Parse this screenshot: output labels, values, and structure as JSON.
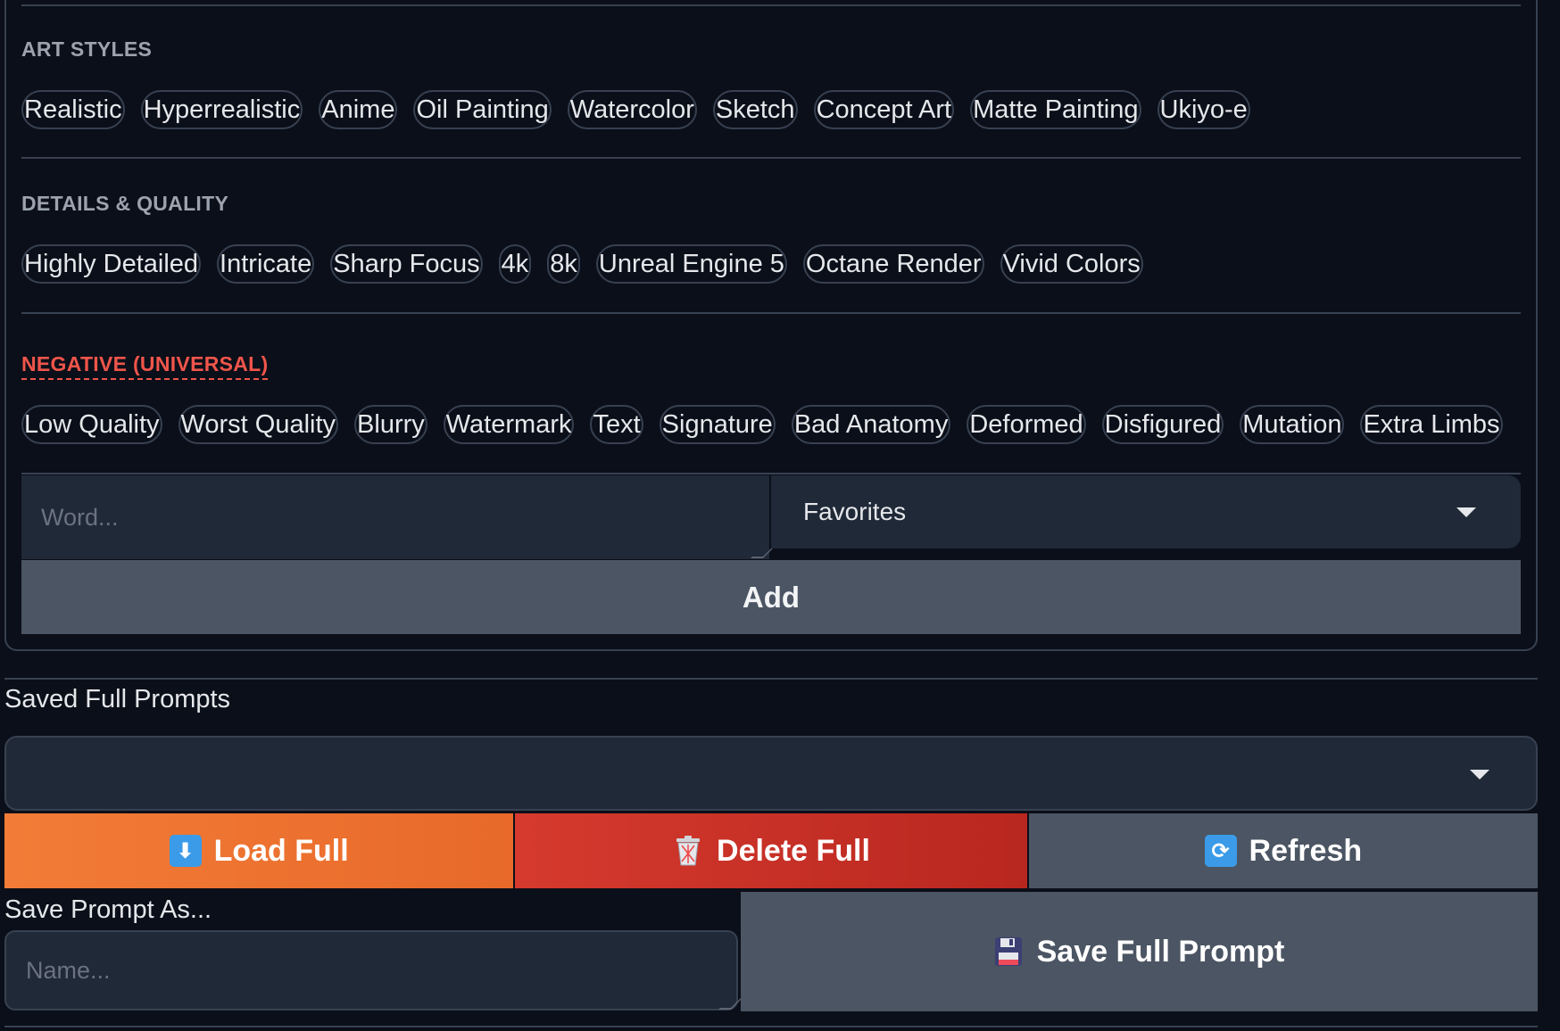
{
  "sections": {
    "art_styles": {
      "title": "ART STYLES",
      "chips": [
        "Realistic",
        "Hyperrealistic",
        "Anime",
        "Oil Painting",
        "Watercolor",
        "Sketch",
        "Concept Art",
        "Matte Painting",
        "Ukiyo-e"
      ]
    },
    "details_quality": {
      "title": "DETAILS & QUALITY",
      "chips": [
        "Highly Detailed",
        "Intricate",
        "Sharp Focus",
        "4k",
        "8k",
        "Unreal Engine 5",
        "Octane Render",
        "Vivid Colors"
      ]
    },
    "negative": {
      "title": "NEGATIVE (UNIVERSAL)",
      "chips": [
        "Low Quality",
        "Worst Quality",
        "Blurry",
        "Watermark",
        "Text",
        "Signature",
        "Bad Anatomy",
        "Deformed",
        "Disfigured",
        "Mutation",
        "Extra Limbs"
      ]
    }
  },
  "word_input": {
    "placeholder": "Word...",
    "value": ""
  },
  "favorites_dropdown": {
    "selected": "Favorites",
    "icon": "chevron-down-icon"
  },
  "add_button": {
    "label": "Add"
  },
  "saved_prompts": {
    "label": "Saved Full Prompts",
    "selected": "",
    "icon": "chevron-down-icon"
  },
  "actions": {
    "load_full": {
      "label": "Load Full",
      "icon": "down-arrow-icon",
      "color": "#f27c37"
    },
    "delete_full": {
      "label": "Delete Full",
      "icon": "trash-icon",
      "color": "#d63a2e"
    },
    "refresh": {
      "label": "Refresh",
      "icon": "refresh-icon",
      "color": "#4b5563"
    }
  },
  "save_as": {
    "label": "Save Prompt As...",
    "placeholder": "Name...",
    "value": ""
  },
  "save_full_button": {
    "label": "Save Full Prompt",
    "icon": "floppy-disk-icon"
  },
  "colors": {
    "background": "#0b0f19",
    "border": "#374151",
    "input_bg": "#1f2937",
    "negative_accent": "#f0554b"
  }
}
